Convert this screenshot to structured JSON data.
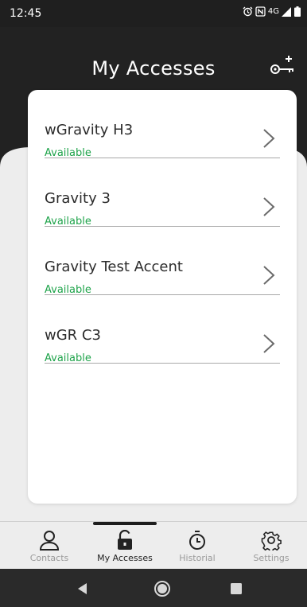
{
  "status_bar": {
    "time": "12:45",
    "network": "4G"
  },
  "header": {
    "title": "My Accesses",
    "add_key_icon": "key-plus-icon"
  },
  "accesses": [
    {
      "name": "wGravity H3",
      "status": "Available"
    },
    {
      "name": "Gravity 3",
      "status": "Available"
    },
    {
      "name": "Gravity Test Accent",
      "status": "Available"
    },
    {
      "name": "wGR C3",
      "status": "Available"
    }
  ],
  "bottom_nav": {
    "items": [
      {
        "label": "Contacts",
        "icon": "person-icon"
      },
      {
        "label": "My Accesses",
        "icon": "padlock-open-icon"
      },
      {
        "label": "Historial",
        "icon": "stopwatch-icon"
      },
      {
        "label": "Settings",
        "icon": "gear-icon"
      }
    ],
    "active_index": 1
  },
  "colors": {
    "header_bg": "#222222",
    "status_available": "#1ea34a",
    "content_bg": "#ededed",
    "card_bg": "#ffffff"
  }
}
